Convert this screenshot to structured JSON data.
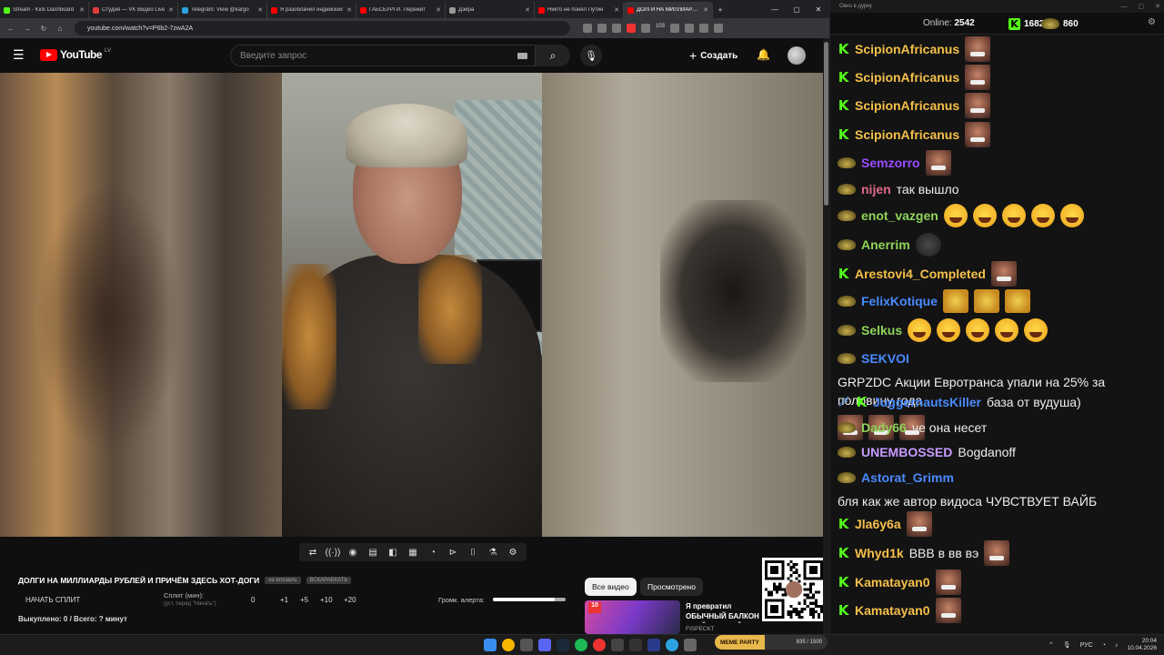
{
  "browser": {
    "tabs": [
      {
        "label": "Stream - Kick Dashboard",
        "color": "#53fc18"
      },
      {
        "label": "Студия — VK Видео Live",
        "color": "#e33b3b"
      },
      {
        "label": "Telegram: View @kargo",
        "color": "#2aa3e0"
      },
      {
        "label": "Я разоблачил индийских",
        "color": "#f00"
      },
      {
        "label": "ГАБСБУРГИ. Пережит",
        "color": "#f00"
      },
      {
        "label": "Дэйра",
        "color": "#999"
      },
      {
        "label": "Никто не понял Путин",
        "color": "#f00"
      },
      {
        "label": "ДОЛГИ НА МИЛЛИАРДЫ",
        "color": "#f00"
      }
    ],
    "active_tab": 7,
    "url": "youtube.com/watch?v=P6b2-7zwA2A",
    "ext_badge": "103"
  },
  "youtube": {
    "logo": "YouTube",
    "country": "LV",
    "search_placeholder": "Введите запрос",
    "create_label": "Создать",
    "video_title": "ДОЛГИ НА МИЛЛИАРДЫ РУБЛЕЙ И ПРИЧЁМ ЗДЕСЬ ХОТ-ДОГИ",
    "pill_1": "на вплавль",
    "pill_2": "ВСКАРАБКАТЬ",
    "split_start": "НАЧАТЬ СПЛИТ",
    "split_label": "Сплит (мин):",
    "split_hint": "(уст. перед \"Начать\")",
    "split_values": [
      "0",
      "+1",
      "+5",
      "+10",
      "+20"
    ],
    "alert_label": "Громк. алерта:",
    "alert_volume": 0.85,
    "bought": "Выкуплено: 0 / Всего: ? минут",
    "chip_all": "Все видео",
    "chip_watched": "Просмотрено",
    "rec_title": "Я превратил ОБЫЧНЫЙ БАЛКОН в ГЕЙМЕРСКИЙ",
    "rec_channel": "FISPECKT",
    "rec_badge": "10"
  },
  "chat": {
    "window_title": "Окно в дурку",
    "online_label": "Online:",
    "online_count": "2542",
    "kick_viewers": "1682",
    "twitch_viewers": "860",
    "messages": [
      {
        "platform": "kick",
        "user": "ScipionAfricanus",
        "color": "#f5c04a",
        "text": "",
        "emotes": [
          "face"
        ]
      },
      {
        "platform": "kick",
        "user": "ScipionAfricanus",
        "color": "#f5c04a",
        "text": "",
        "emotes": [
          "face"
        ]
      },
      {
        "platform": "kick",
        "user": "ScipionAfricanus",
        "color": "#f5c04a",
        "text": "",
        "emotes": [
          "face"
        ]
      },
      {
        "platform": "kick",
        "user": "ScipionAfricanus",
        "color": "#f5c04a",
        "text": "",
        "emotes": [
          "face"
        ]
      },
      {
        "platform": "twitch",
        "user": "Semzorro",
        "color": "#9b4dff",
        "text": "",
        "emotes": [
          "face"
        ]
      },
      {
        "platform": "twitch",
        "user": "nijen",
        "color": "#e06b8b",
        "text": "так вышло",
        "emotes": []
      },
      {
        "platform": "twitch",
        "user": "enot_vazgen",
        "color": "#8fd45a",
        "text": "",
        "emotes": [
          "laugh",
          "laugh",
          "laugh",
          "laugh",
          "laugh"
        ]
      },
      {
        "platform": "twitch",
        "user": "Anerrim",
        "color": "#8fd45a",
        "text": "",
        "emotes": [
          "cat"
        ]
      },
      {
        "platform": "kick",
        "user": "Arestovi4_Completed",
        "color": "#f5c04a",
        "text": "",
        "emotes": [
          "face"
        ]
      },
      {
        "platform": "twitch",
        "user": "FelixKotique",
        "color": "#4a8aff",
        "text": "",
        "emotes": [
          "tiger",
          "tiger",
          "tiger"
        ]
      },
      {
        "platform": "twitch",
        "user": "Selkus",
        "color": "#8fd45a",
        "text": "",
        "emotes": [
          "laugh",
          "laugh",
          "laugh",
          "laugh",
          "laugh"
        ]
      },
      {
        "platform": "twitch",
        "user": "SEKVOI",
        "color": "#4a8aff",
        "text": "GRPZDC Акции Евротранса упали на 25% за половину года",
        "emotes": [
          "face",
          "face",
          "face"
        ]
      },
      {
        "platform": "kick",
        "user": "JuggernautsKiller",
        "color": "#4a8aff",
        "text": "база от вудуша)",
        "emotes": [],
        "sword": true
      },
      {
        "platform": "twitch",
        "user": "Dady66",
        "color": "#8fd45a",
        "text": "че она несет",
        "emotes": []
      },
      {
        "platform": "twitch",
        "user": "UNEMBOSSED",
        "color": "#c79bff",
        "text": "Bogdanoff",
        "emotes": []
      },
      {
        "platform": "twitch",
        "user": "Astorat_Grimm",
        "color": "#4a8aff",
        "text": "бля как же автор видоса ЧУВСТВУЕТ ВАЙБ",
        "emotes": []
      },
      {
        "platform": "kick",
        "user": "Jla6y6a",
        "color": "#f5c04a",
        "text": "",
        "emotes": [
          "face"
        ]
      },
      {
        "platform": "kick",
        "user": "Whyd1k",
        "color": "#f5c04a",
        "text": "ВВВ в вв вэ",
        "emotes": [
          "face"
        ]
      },
      {
        "platform": "kick",
        "user": "Kamatayan0",
        "color": "#f5c04a",
        "text": "",
        "emotes": [
          "face"
        ]
      },
      {
        "platform": "kick",
        "user": "Kamatayan0",
        "color": "#f5c04a",
        "text": "",
        "emotes": [
          "face"
        ]
      }
    ]
  },
  "taskbar": {
    "meme_party": "MEME PARTY",
    "meme_progress": "835 / 1500",
    "lang": "РУС",
    "time": "20:04",
    "date": "10.04.2026"
  }
}
